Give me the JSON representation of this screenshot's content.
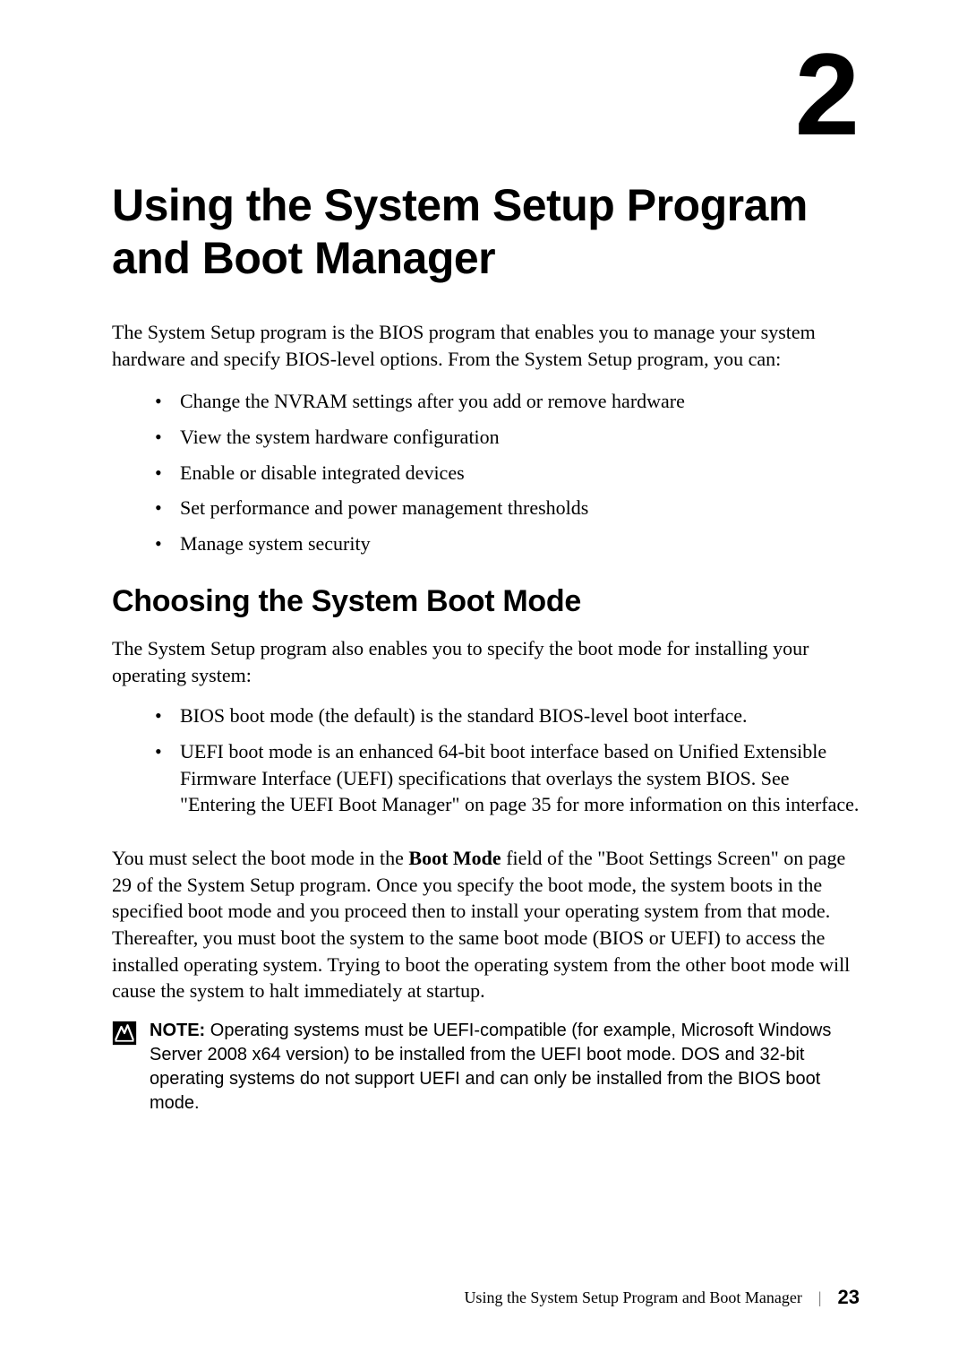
{
  "chapter_number": "2",
  "title": "Using the System Setup Program and Boot Manager",
  "intro": "The System Setup program is the BIOS program that enables you to manage your system hardware and specify BIOS-level options. From the System Setup program, you can:",
  "intro_bullets": [
    "Change the NVRAM settings after you add or remove hardware",
    "View the system hardware configuration",
    "Enable or disable integrated devices",
    "Set performance and power management thresholds",
    "Manage system security"
  ],
  "section_heading": "Choosing the System Boot Mode",
  "section_intro": "The System Setup program also enables you to specify the boot mode for installing your operating system:",
  "section_bullets": [
    "BIOS boot mode (the default) is the standard BIOS-level boot interface.",
    "UEFI boot mode is an enhanced 64-bit boot interface based on Unified Extensible Firmware Interface (UEFI) specifications that overlays the system BIOS. See \"Entering the UEFI Boot Manager\" on page 35 for more information on this interface."
  ],
  "boot_mode_paragraph_pre": "You must select the boot mode in the ",
  "boot_mode_field": "Boot Mode",
  "boot_mode_paragraph_post": " field of the \"Boot Settings Screen\" on page 29 of the System Setup program. Once you specify the boot mode, the system boots in the specified boot mode and you proceed then to install your operating system from that mode. Thereafter, you must boot the system to the same boot mode (BIOS or UEFI) to access the installed operating system. Trying to boot the operating system from the other boot mode will cause the system to halt immediately at startup.",
  "note_label": "NOTE:",
  "note_text": " Operating systems must be UEFI-compatible (for example, Microsoft Windows Server 2008 x64 version) to be installed from the UEFI boot mode. DOS and 32-bit operating systems do not support UEFI and can only be installed from the BIOS boot mode.",
  "footer_title": "Using the System Setup Program and Boot Manager",
  "footer_sep": "|",
  "page_number": "23"
}
